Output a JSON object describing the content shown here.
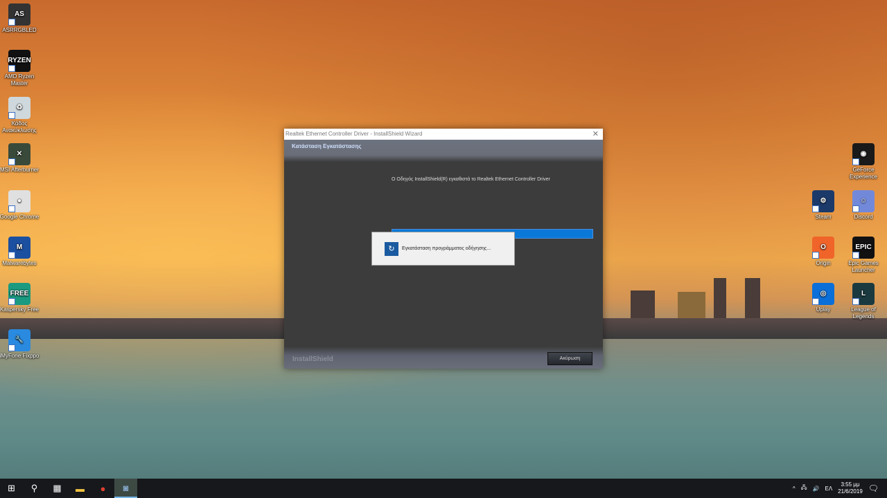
{
  "desktop": {
    "left_icons": [
      {
        "label": "ASRRGBLED",
        "color": "#333",
        "glyph": "AS"
      },
      {
        "label": "AMD Ryzen Master",
        "color": "#111",
        "glyph": "RYZEN"
      },
      {
        "label": "Κάδος Ανακύκλωσης",
        "color": "#cfd8dc",
        "glyph": "♻"
      },
      {
        "label": "MSI Afterburner",
        "color": "#3a4a3a",
        "glyph": "✕"
      },
      {
        "label": "Google Chrome",
        "color": "#e0e0e0",
        "glyph": "●"
      },
      {
        "label": "Malwarebytes",
        "color": "#1b4fa0",
        "glyph": "M"
      },
      {
        "label": "Kaspersky Free",
        "color": "#1a9a80",
        "glyph": "FREE"
      },
      {
        "label": "iMyFone Fixppo",
        "color": "#2a8ae0",
        "glyph": "🔧"
      }
    ],
    "right_icons": [
      {
        "label": "GeForce Experience",
        "color": "#1a1a1a",
        "glyph": "◉"
      },
      {
        "label": "Steam",
        "color": "#1b3a6a",
        "glyph": "⚙"
      },
      {
        "label": "Discord",
        "color": "#7289da",
        "glyph": "☺"
      },
      {
        "label": "Origin",
        "color": "#f0642a",
        "glyph": "O"
      },
      {
        "label": "Epic Games Launcher",
        "color": "#111",
        "glyph": "EPIC"
      },
      {
        "label": "Uplay",
        "color": "#0a6fd8",
        "glyph": "◎"
      },
      {
        "label": "League of Legends",
        "color": "#1a3a40",
        "glyph": "L"
      }
    ]
  },
  "wizard": {
    "title": "Realtek Ethernet Controller Driver - InstallShield Wizard",
    "header": "Κατάσταση Εγκατάστασης",
    "message": "Ο Οδηγός InstallShield(R) εγκαθιστά το Realtek Ethernet Controller Driver",
    "progress_percent": 100,
    "brand": "InstallShield",
    "cancel": "Ακύρωση"
  },
  "popup": {
    "text": "Εγκατάσταση προγράμματος οδήγησης..."
  },
  "taskbar": {
    "language": "ΕΛ",
    "time": "3:55 μμ",
    "date": "21/6/2019"
  }
}
